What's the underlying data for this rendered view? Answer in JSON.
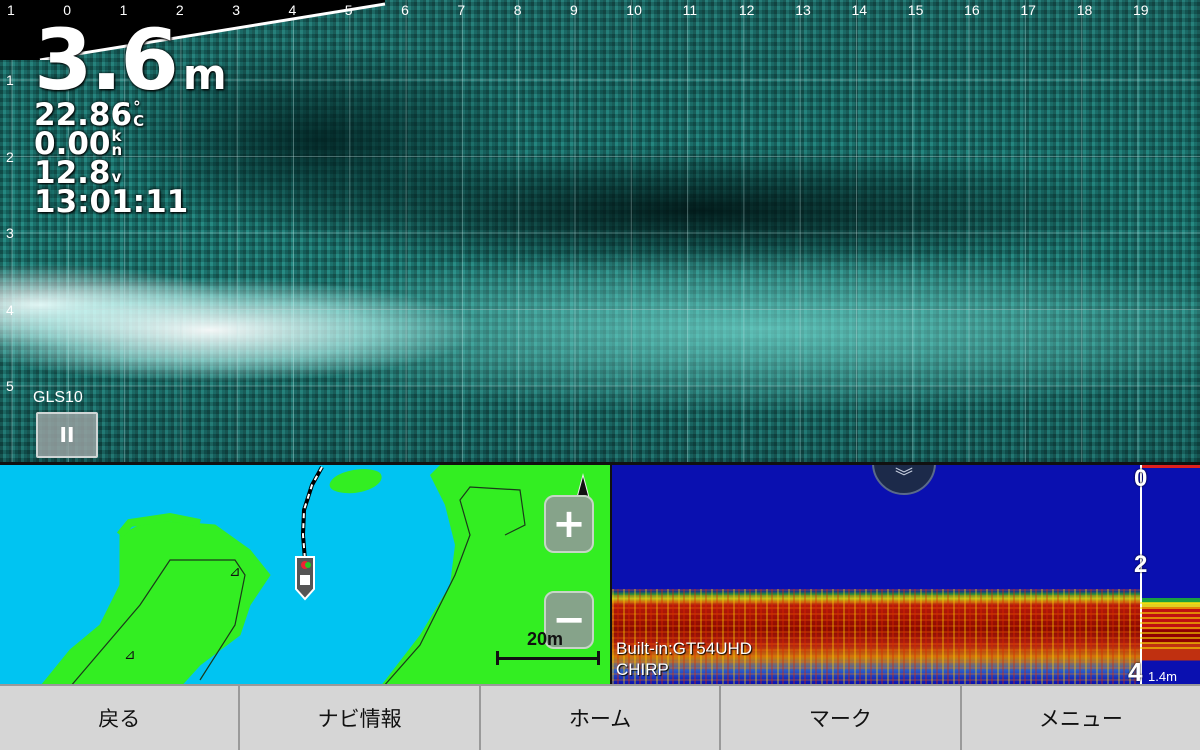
{
  "livescope": {
    "x_ticks": [
      "1",
      "0",
      "1",
      "2",
      "3",
      "4",
      "5",
      "6",
      "7",
      "8",
      "9",
      "10",
      "11",
      "12",
      "13",
      "14",
      "15",
      "16",
      "17",
      "18",
      "19"
    ],
    "y_ticks": [
      "1",
      "2",
      "3",
      "4",
      "5"
    ],
    "depth_value": "3.6",
    "depth_unit": "m",
    "water_temp": "22.86",
    "water_temp_unit": [
      "°",
      "C"
    ],
    "speed": "0.00",
    "speed_unit": [
      "k",
      "n"
    ],
    "voltage": "12.8",
    "voltage_unit": "v",
    "time": "13:01:11",
    "transducer_label": "GLS10",
    "pause_icon": "pause-icon",
    "pause_glyph": "II",
    "colors": {
      "echo": "#7fe8de",
      "background": "#1a7a74"
    }
  },
  "map": {
    "zoom_in_label": "+",
    "zoom_out_label": "−",
    "scale_label": "20m",
    "colors": {
      "water": "#00c4f2",
      "land": "#33ee22"
    }
  },
  "sonar": {
    "depth_ticks": [
      "0",
      "2",
      "4"
    ],
    "range_label": "1.4m",
    "source_label": "Built-in:GT54UHD",
    "mode_label": "CHIRP",
    "collapse_glyph": "︾",
    "colors": {
      "water": "#0a10b0",
      "bottom": "#b81a0a"
    }
  },
  "nav": {
    "back": "戻る",
    "nav_info": "ナビ情報",
    "home": "ホーム",
    "mark": "マーク",
    "menu": "メニュー"
  }
}
